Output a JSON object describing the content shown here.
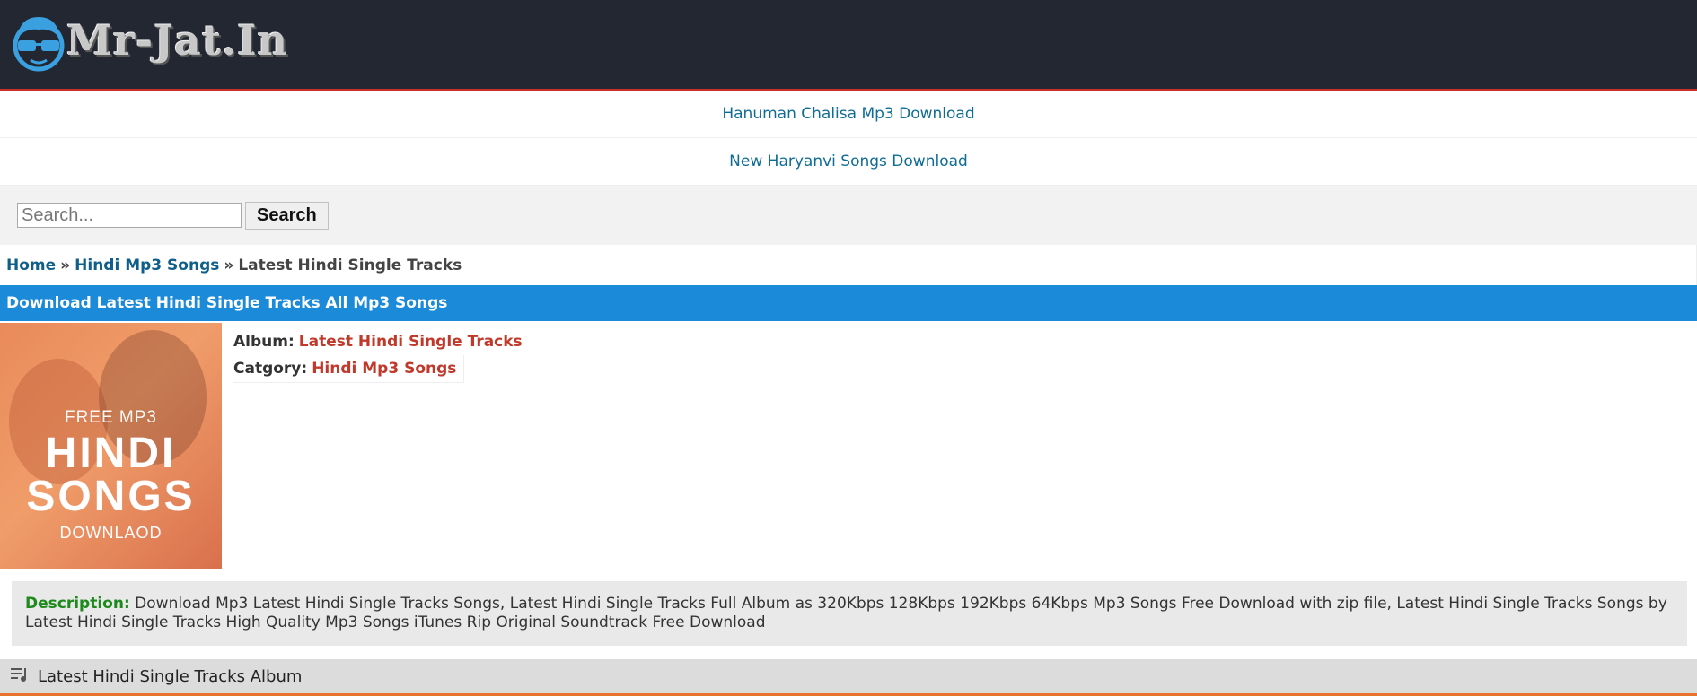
{
  "header": {
    "logo_text": "Mr-Jat.In"
  },
  "nav_links": [
    {
      "label": "Hanuman Chalisa Mp3 Download"
    },
    {
      "label": "New Haryanvi Songs Download"
    }
  ],
  "search": {
    "placeholder": "Search...",
    "button_label": "Search"
  },
  "breadcrumb": {
    "home": "Home",
    "sep": "»",
    "category": "Hindi Mp3 Songs",
    "current": "Latest Hindi Single Tracks"
  },
  "page_title": "Download Latest Hindi Single Tracks All Mp3 Songs",
  "album": {
    "cover": {
      "line1": "FREE MP3",
      "line2": "HINDI",
      "line3": "SONGS",
      "line4": "DOWNLAOD"
    },
    "album_label": "Album:",
    "album_value": "Latest Hindi Single Tracks",
    "category_label": "Catgory:",
    "category_value": "Hindi Mp3 Songs"
  },
  "description": {
    "label": "Description:",
    "text": "Download Mp3 Latest Hindi Single Tracks Songs, Latest Hindi Single Tracks Full Album as 320Kbps 128Kbps 192Kbps 64Kbps Mp3 Songs Free Download with zip file, Latest Hindi Single Tracks Songs by Latest Hindi Single Tracks High Quality Mp3 Songs iTunes Rip Original Soundtrack Free Download"
  },
  "section": {
    "title": "Latest Hindi Single Tracks Album",
    "icon": "playlist-icon"
  },
  "colors": {
    "header_bg": "#222732",
    "accent_blue": "#1b8ad8",
    "link_red": "#c0392b",
    "section_border": "#e8742e"
  }
}
